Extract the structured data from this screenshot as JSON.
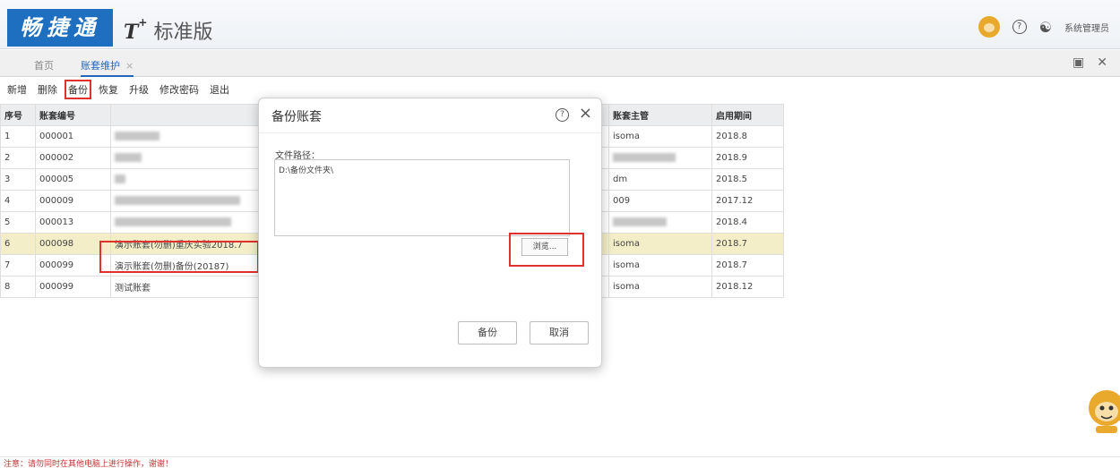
{
  "header": {
    "logo_text": "畅捷通",
    "edition_t": "T",
    "edition_plus": "+",
    "edition_label": "标准版",
    "user_name": "系统管理员"
  },
  "tabs": [
    {
      "label": "首页"
    },
    {
      "label": "账套维护"
    }
  ],
  "tab_close": "×",
  "toolbar": [
    "新增",
    "删除",
    "备份",
    "恢复",
    "升级",
    "修改密码",
    "退出"
  ],
  "grid": {
    "headers": {
      "idx": "序号",
      "code": "账套编号",
      "name": "",
      "owner": "账套主管",
      "period": "启用期间"
    },
    "rows": [
      {
        "idx": "1",
        "code": "000001",
        "name": "",
        "owner": "isoma",
        "period": "2018.8"
      },
      {
        "idx": "2",
        "code": "000002",
        "name": "",
        "owner": "",
        "period": "2018.9"
      },
      {
        "idx": "3",
        "code": "000005",
        "name": "",
        "owner": "dm",
        "period": "2018.5"
      },
      {
        "idx": "4",
        "code": "000009",
        "name": "",
        "owner": "009",
        "period": "2017.12"
      },
      {
        "idx": "5",
        "code": "000013",
        "name": "",
        "owner": "",
        "period": "2018.4"
      },
      {
        "idx": "6",
        "code": "000098",
        "name": "演示账套(勿删)重庆实验2018.7",
        "owner": "isoma",
        "period": "2018.7"
      },
      {
        "idx": "7",
        "code": "000099",
        "name": "演示账套(勿删)备份(20187)",
        "owner": "isoma",
        "period": "2018.7"
      },
      {
        "idx": "8",
        "code": "000099",
        "name": "测试账套",
        "owner": "isoma",
        "period": "2018.12"
      }
    ]
  },
  "dialog": {
    "title": "备份账套",
    "help": "?",
    "close": "×",
    "path_label": "文件路径：",
    "path_value": "D:\\备份文件夹\\",
    "browse_label": "浏览...",
    "ok_label": "备份",
    "cancel_label": "取消"
  },
  "status_text": "注意：请勿同时在其他电脑上进行操作，谢谢！",
  "colors": {
    "brand": "#1f6fc0",
    "highlight": "#e03030",
    "selected_row": "#f3eec8"
  }
}
